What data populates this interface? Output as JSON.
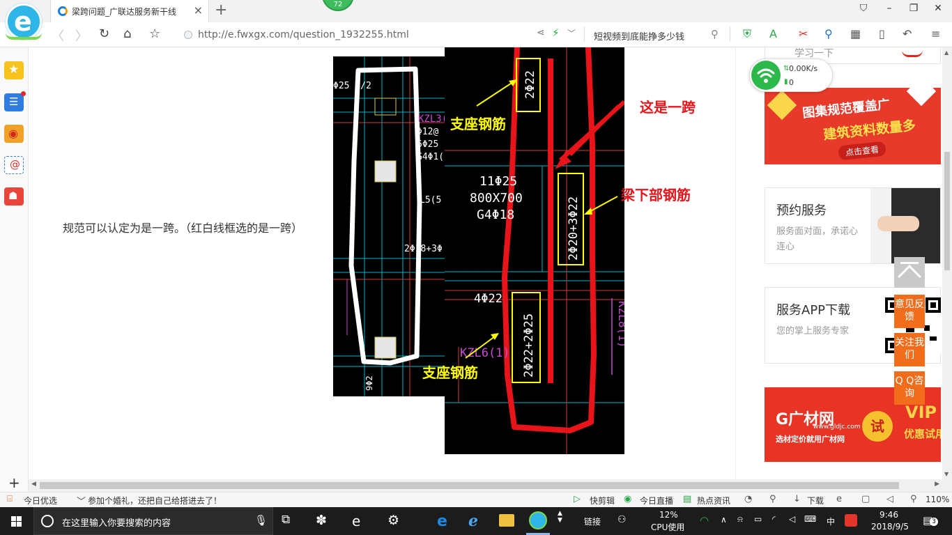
{
  "browser": {
    "tab_title": "梁跨问题_广联达服务新干线",
    "badge": "72",
    "url": "http://e.fwxgx.com/question_1932255.html",
    "search_text": "短视频到底能挣多少钱"
  },
  "content": {
    "answer_text": "规范可以认定为是一跨。（红白线框选的是一跨）",
    "cad": {
      "left_labels": [
        "Φ25 6/2",
        "KZL3(",
        "Φ12@",
        "6Φ25",
        "G4Φ1(",
        "L5(5",
        "2Φ18+3Φ",
        "9Φ2"
      ],
      "right_labels": {
        "bar_top": "2Φ22",
        "beam_1": "11Φ25",
        "beam_2": "800X700",
        "beam_3": "G4Φ18",
        "bar_mid": "2Φ20+3Φ22",
        "bar_left": "4Φ22",
        "bar_bottom": "2Φ22+2Φ25",
        "kzl6": "KZL6(1)",
        "kzl8": "KZL8(1)"
      },
      "annotations": {
        "support_top": "支座钢筋",
        "one_span": "这是一跨",
        "beam_bottom": "梁下部钢筋",
        "support_bottom": "支座钢筋"
      }
    }
  },
  "right_panel": {
    "partial_top": "学习一下",
    "banner1": {
      "line1": "图集规范覆盖广",
      "line2": "建筑资料数量多",
      "cta": "点击查看"
    },
    "card1": {
      "title": "预约服务",
      "desc": "服务面对面，承诺心连心"
    },
    "card2": {
      "title": "服务APP下载",
      "desc": "您的掌上服务专家"
    },
    "banner2": {
      "logo": "G广材网",
      "site": "www.gldjc.com",
      "sub": "选材定价就用广材网",
      "try": "试",
      "vip": "VIP",
      "vip_sub": "优惠试用"
    }
  },
  "speed_widget": {
    "rate": "0.00K/s",
    "count": "0"
  },
  "float_buttons": {
    "feedback": "意见反馈",
    "follow": "关注我们",
    "qq": "Q Q咨询"
  },
  "statusbar": {
    "today_pick": "今日优选",
    "news": "参加个婚礼，还把自己给搭进去了！",
    "quick_edit": "快剪辑",
    "live": "今日直播",
    "hot": "热点资讯",
    "download": "下载",
    "zoom": "110%"
  },
  "taskbar": {
    "search_placeholder": "在这里输入你要搜索的内容",
    "link_label": "链接",
    "cpu_percent": "12%",
    "cpu_label": "CPU使用",
    "ime": "中",
    "time": "9:46",
    "date": "2018/9/5",
    "notifications": "3"
  },
  "colors": {
    "accent_green": "#2db84b",
    "brand_red": "#e73425",
    "cad_yellow": "#ffff00",
    "cad_red": "#e8141a"
  }
}
